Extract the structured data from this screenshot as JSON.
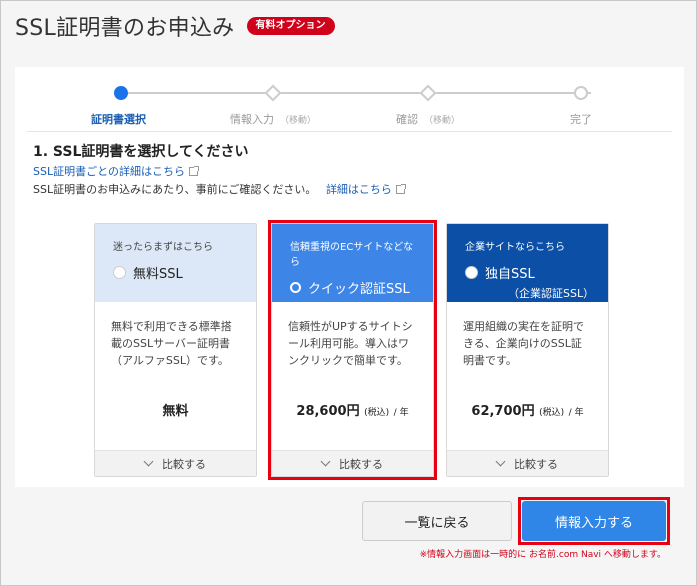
{
  "header": {
    "title": "SSL証明書のお申込み",
    "badge": "有料オプション"
  },
  "stepper": {
    "steps": [
      {
        "label": "証明書選択",
        "note": ""
      },
      {
        "label": "情報入力",
        "note": "（移動）"
      },
      {
        "label": "確認",
        "note": "（移動）"
      },
      {
        "label": "完了",
        "note": ""
      }
    ]
  },
  "section": {
    "heading": "1. SSL証明書を選択してください",
    "detail_link": "SSL証明書ごとの詳細はこちら",
    "notice": "SSL証明書のお申込みにあたり、事前にご確認ください。",
    "notice_link": "詳細はこちら"
  },
  "plans": [
    {
      "sub": "迷ったらまずはこちら",
      "title": "無料SSL",
      "title_sub": "",
      "description": "無料で利用できる標準搭載のSSLサーバー証明書（アルファSSL）です。",
      "price": "無料",
      "tax": "",
      "unit": "",
      "compare": "比較する"
    },
    {
      "sub": "信頼重視のECサイトなどなら",
      "title": "クイック認証SSL",
      "title_sub": "",
      "description": "信頼性がUPするサイトシール利用可能。導入はワンクリックで簡単です。",
      "price": "28,600円",
      "tax": "(税込)",
      "unit": "/ 年",
      "compare": "比較する"
    },
    {
      "sub": "企業サイトならこちら",
      "title": "独自SSL",
      "title_sub": "（企業認証SSL）",
      "description": "運用組織の実在を証明できる、企業向けのSSL証明書です。",
      "price": "62,700円",
      "tax": "(税込)",
      "unit": "/ 年",
      "compare": "比較する"
    }
  ],
  "actions": {
    "back": "一覧に戻る",
    "next": "情報入力する",
    "footnote": "※情報入力画面は一時的に お名前.com Navi へ移動します。"
  },
  "colors": {
    "accent": "#2f86e6",
    "highlight": "#e60012",
    "badge": "#d0021b"
  }
}
